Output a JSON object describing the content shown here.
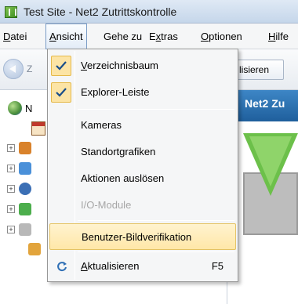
{
  "window": {
    "title": "Test Site - Net2 Zutrittskontrolle"
  },
  "menubar": {
    "items": [
      {
        "label_plain": "",
        "label_ul": "D",
        "label_rest": "atei"
      },
      {
        "label_plain": "",
        "label_ul": "A",
        "label_rest": "nsicht"
      },
      {
        "label_plain": "Gehe zu",
        "label_ul": "",
        "label_rest": ""
      },
      {
        "label_plain": "E",
        "label_ul": "x",
        "label_rest": "tras"
      },
      {
        "label_plain": "",
        "label_ul": "O",
        "label_rest": "ptionen"
      },
      {
        "label_plain": "",
        "label_ul": "H",
        "label_rest": "ilfe"
      }
    ]
  },
  "toolbar": {
    "back_label": "Z",
    "refresh_label": "lisieren"
  },
  "tree": {
    "root_label": "N"
  },
  "content": {
    "header_title": "Net2 Zu"
  },
  "dropdown": {
    "items": [
      {
        "ul": "V",
        "rest": "erzeichnisbaum",
        "plain": "",
        "checked": true
      },
      {
        "ul": "",
        "rest": "",
        "plain": "Explorer-Leiste",
        "checked": true
      },
      {
        "ul": "",
        "rest": "",
        "plain": "Kameras"
      },
      {
        "ul": "",
        "rest": "",
        "plain": "Standortgrafiken"
      },
      {
        "ul": "",
        "rest": "",
        "plain": "Aktionen auslösen"
      },
      {
        "ul": "",
        "rest": "",
        "plain": "I/O-Module",
        "disabled": true
      },
      {
        "ul": "",
        "rest": "",
        "plain": "Benutzer-Bildverifikation",
        "highlighted": true
      },
      {
        "ul": "A",
        "rest": "ktualisieren",
        "plain": "",
        "shortcut": "F5"
      }
    ]
  },
  "colors": {
    "highlight": "#ffe7a8",
    "check_bg": "#fce4a5",
    "header_blue": "#1f5f9c",
    "arrow_green": "#6cc04a"
  }
}
